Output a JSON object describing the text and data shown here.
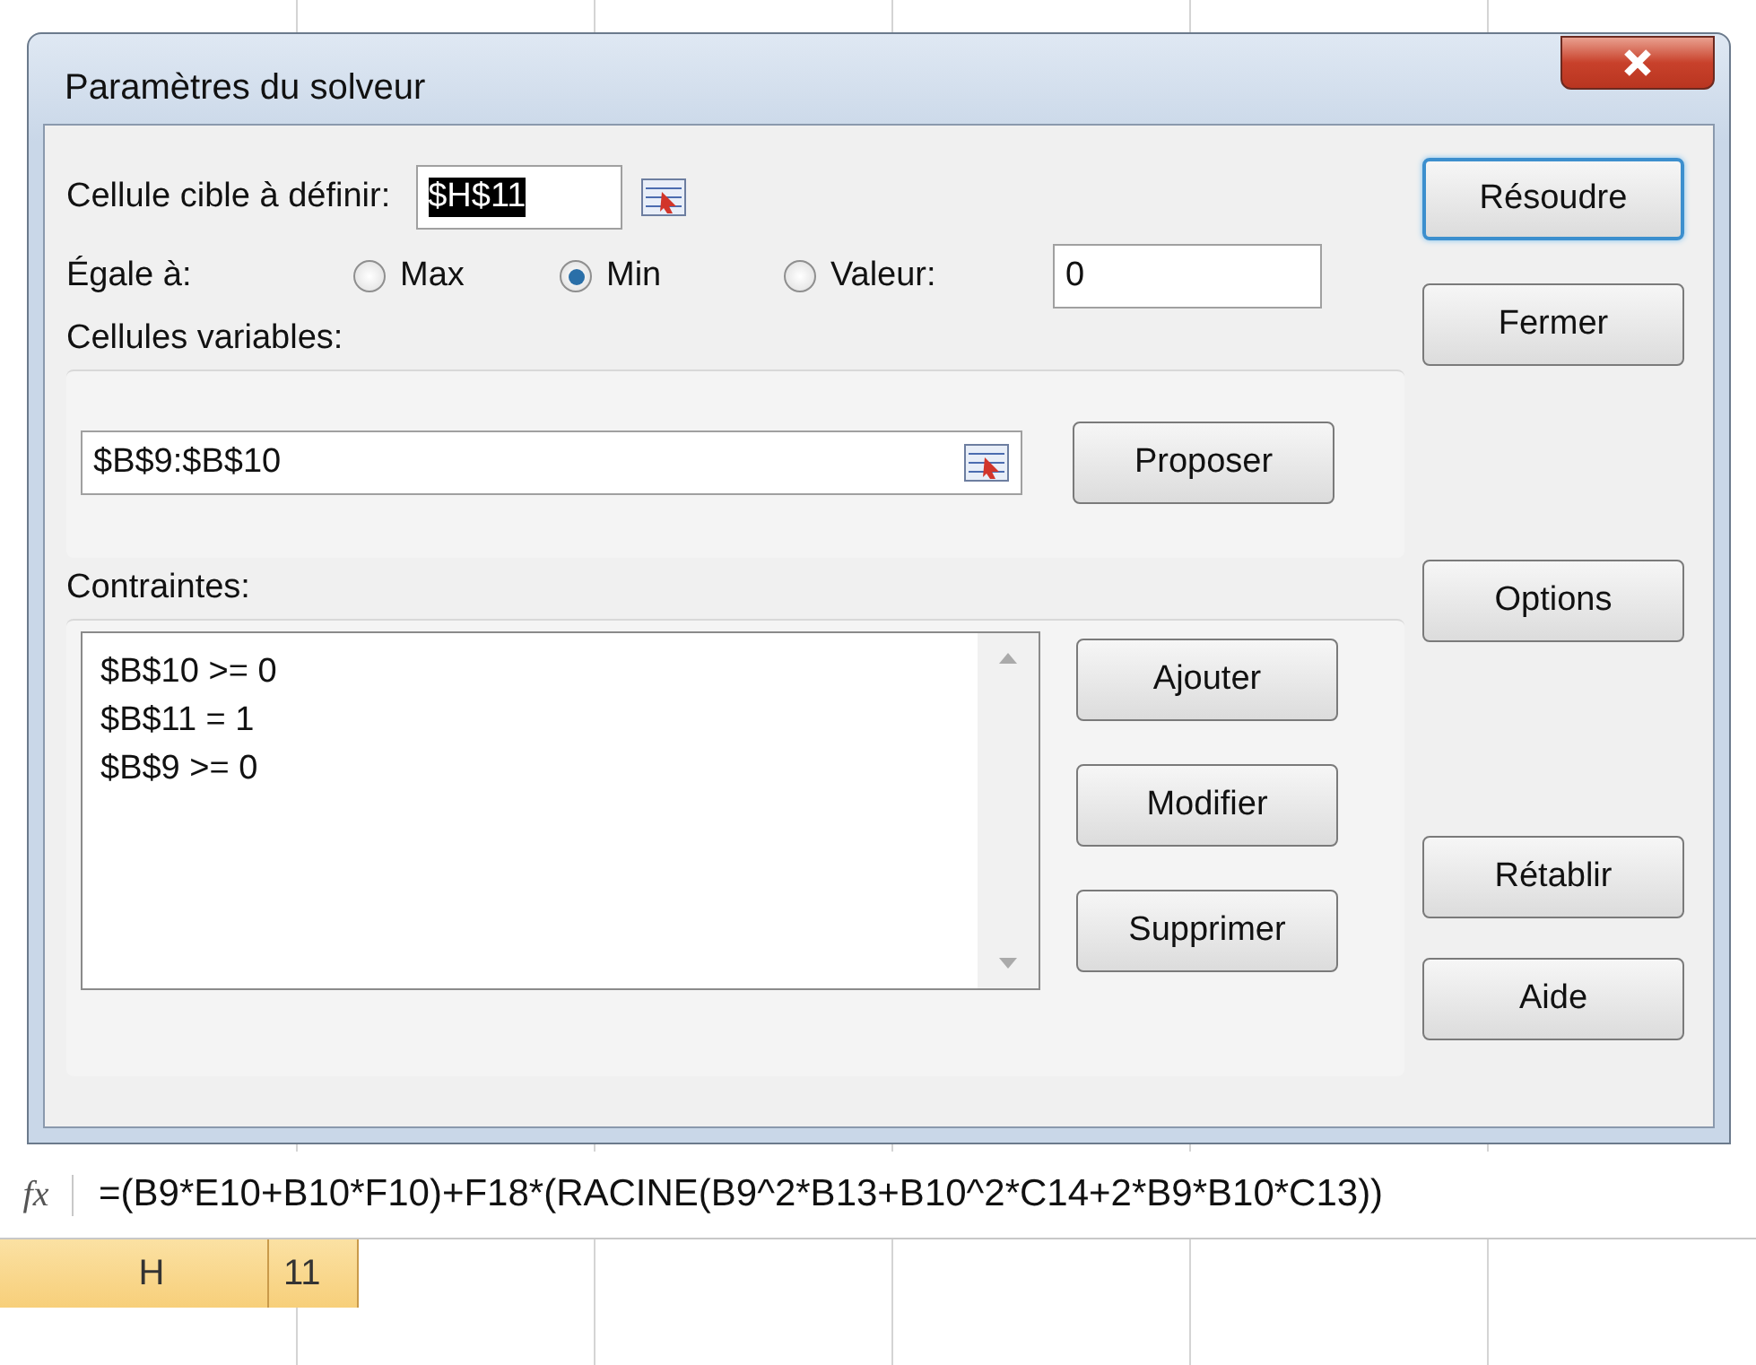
{
  "window": {
    "title": "Paramètres du solveur"
  },
  "target": {
    "label": "Cellule cible à définir:",
    "value": "$H$11",
    "text_selected": true
  },
  "equal_to": {
    "label": "Égale à:",
    "options": [
      {
        "label": "Max",
        "selected": false
      },
      {
        "label": "Min",
        "selected": true
      },
      {
        "label": "Valeur:",
        "selected": false
      }
    ],
    "value": "0"
  },
  "variable_cells": {
    "label": "Cellules variables:",
    "value": "$B$9:$B$10",
    "button": "Proposer"
  },
  "constraints": {
    "label": "Contraintes:",
    "items": [
      "$B$10 >= 0",
      "$B$11 = 1",
      "$B$9 >= 0"
    ],
    "buttons": [
      "Ajouter",
      "Modifier",
      "Supprimer"
    ]
  },
  "side_buttons": [
    {
      "label": "Résoudre",
      "default": true
    },
    {
      "label": "Fermer",
      "default": false
    },
    {
      "label": "Options",
      "default": false
    },
    {
      "label": "Rétablir",
      "default": false
    },
    {
      "label": "Aide",
      "default": false
    }
  ],
  "formula_bar": {
    "icon": "fx",
    "formula": "=(B9*E10+B10*F10)+F18*(RACINE(B9^2*B13+B10^2*C14+2*B9*B10*C13))"
  },
  "headers": {
    "column": "H",
    "row": "11"
  }
}
